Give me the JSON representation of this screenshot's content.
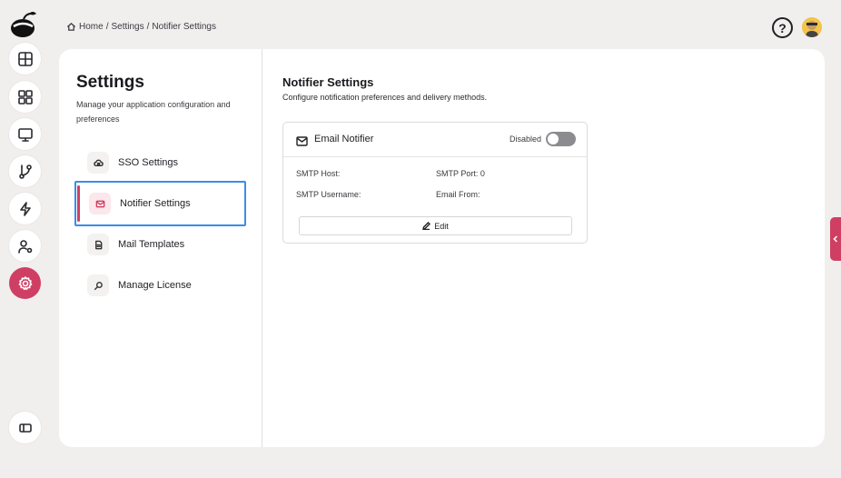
{
  "breadcrumb": {
    "home": "Home",
    "sep1": "/",
    "settings": "Settings",
    "sep2": "/",
    "current": "Notifier Settings"
  },
  "header": {
    "help_label": "?"
  },
  "rail": {
    "items": [
      {
        "icon": "table-icon"
      },
      {
        "icon": "dashboard-icon"
      },
      {
        "icon": "monitor-icon"
      },
      {
        "icon": "git-branch-icon"
      },
      {
        "icon": "lightning-icon"
      },
      {
        "icon": "user-settings-icon"
      },
      {
        "icon": "gear-icon",
        "active": true
      }
    ],
    "bottom_icon": "sidebar-toggle-icon",
    "accent_color": "#cf3f63"
  },
  "settings": {
    "title": "Settings",
    "description": "Manage your application configuration and preferences",
    "nav": [
      {
        "label": "SSO Settings",
        "icon": "cloud-lock-icon"
      },
      {
        "label": "Notifier Settings",
        "icon": "mail-icon",
        "active": true
      },
      {
        "label": "Mail Templates",
        "icon": "document-icon"
      },
      {
        "label": "Manage License",
        "icon": "key-search-icon"
      }
    ]
  },
  "notifier": {
    "title": "Notifier Settings",
    "description": "Configure notification preferences and delivery methods.",
    "card": {
      "title": "Email Notifier",
      "status_label": "Disabled",
      "enabled": false,
      "fields": {
        "smtp_host_label": "SMTP Host:",
        "smtp_host_value": "",
        "smtp_port_label": "SMTP Port:",
        "smtp_port_value": "0",
        "smtp_username_label": "SMTP Username:",
        "smtp_username_value": "",
        "email_from_label": "Email From:",
        "email_from_value": ""
      },
      "edit_label": "Edit"
    }
  }
}
